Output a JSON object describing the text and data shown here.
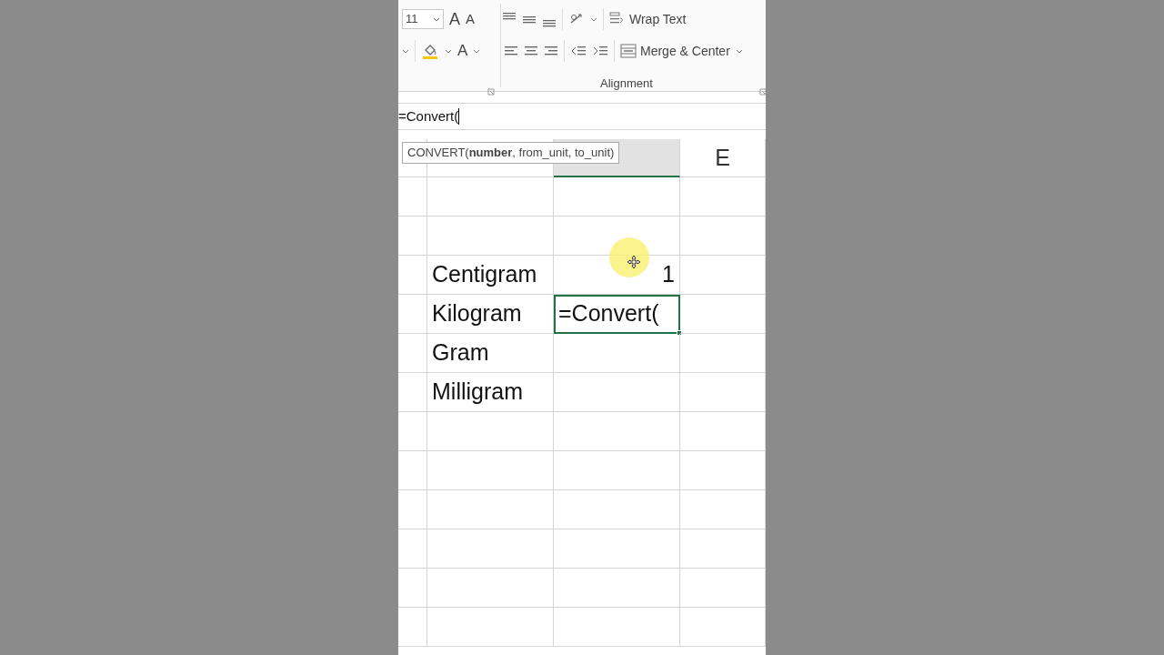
{
  "ribbon": {
    "font_size": "11",
    "grow_font_label": "A",
    "shrink_font_label": "A",
    "font_color_label": "A",
    "wrap_text": "Wrap Text",
    "merge_center": "Merge & Center",
    "group_label": "Alignment"
  },
  "formula_bar": {
    "value": "=Convert("
  },
  "tooltip": {
    "text": "CONVERT(**number**, from_unit, to_unit)"
  },
  "columns": [
    {
      "selected": false
    },
    {
      "selected": false
    },
    {
      "selected": true
    },
    {
      "label": "E",
      "selected": false
    }
  ],
  "rows": [
    {
      "active": false
    },
    {
      "active": false
    },
    {
      "column_c": "Centigram",
      "column_d": "1",
      "active": false
    },
    {
      "column_c": "Kilogram",
      "column_d": "=Convert(",
      "active": true
    },
    {
      "column_c": "Gram",
      "active": false
    },
    {
      "column_c": "Milligram",
      "active": false
    },
    {
      "active": false
    },
    {
      "active": false
    },
    {
      "active": false
    },
    {
      "active": false
    },
    {
      "active": false
    },
    {
      "active": false
    }
  ]
}
